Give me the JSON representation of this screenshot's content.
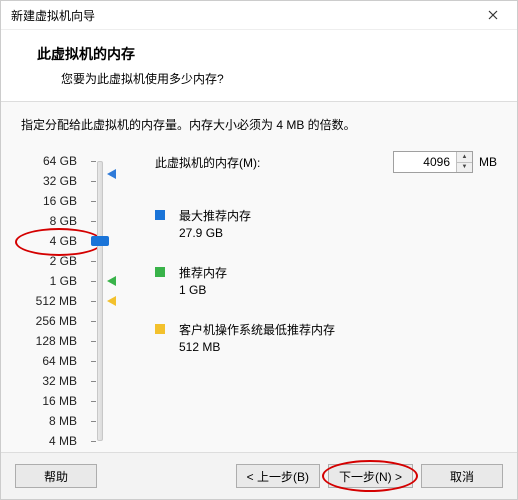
{
  "titlebar": {
    "title": "新建虚拟机向导"
  },
  "header": {
    "heading": "此虚拟机的内存",
    "sub": "您要为此虚拟机使用多少内存?"
  },
  "body": {
    "instruction": "指定分配给此虚拟机的内存量。内存大小必须为 4 MB 的倍数。",
    "scale": [
      "64 GB",
      "32 GB",
      "16 GB",
      "8 GB",
      "4 GB",
      "2 GB",
      "1 GB",
      "512 MB",
      "256 MB",
      "128 MB",
      "64 MB",
      "32 MB",
      "16 MB",
      "8 MB",
      "4 MB"
    ],
    "field_label": "此虚拟机的内存(M):",
    "value": "4096",
    "unit": "MB",
    "max": {
      "label": "最大推荐内存",
      "value": "27.9 GB"
    },
    "rec": {
      "label": "推荐内存",
      "value": "1 GB"
    },
    "min": {
      "label": "客户机操作系统最低推荐内存",
      "value": "512 MB"
    }
  },
  "footer": {
    "help": "帮助",
    "back": "< 上一步(B)",
    "next": "下一步(N) >",
    "cancel": "取消"
  }
}
